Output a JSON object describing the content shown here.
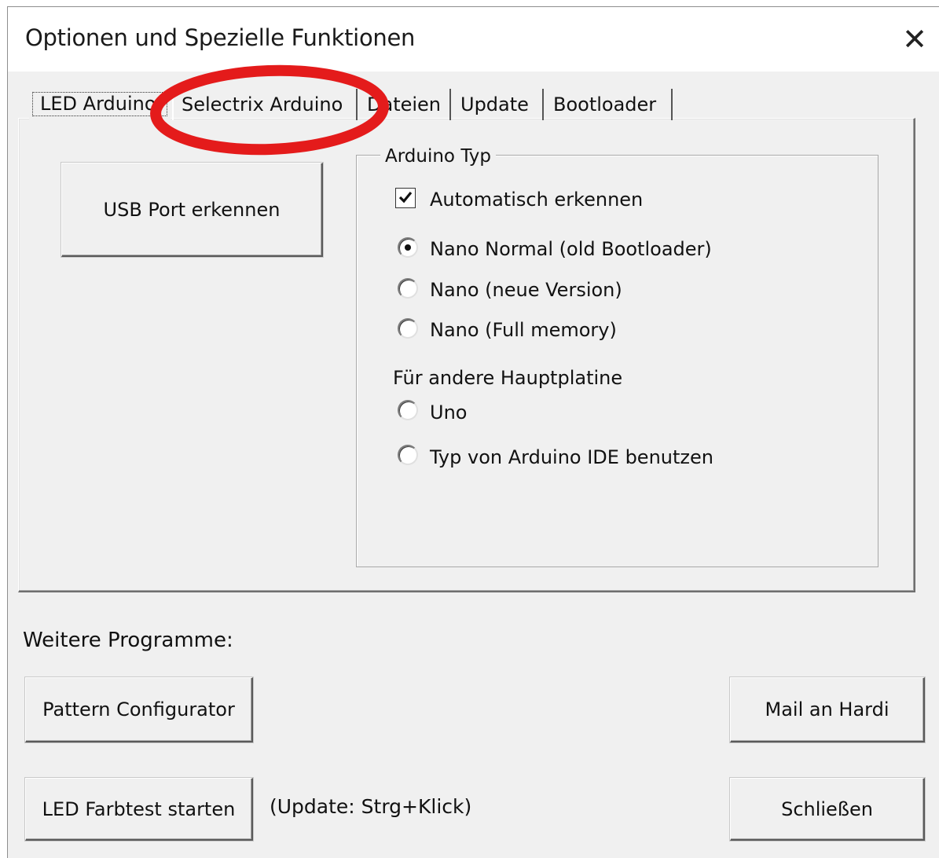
{
  "window": {
    "title": "Optionen und Spezielle Funktionen",
    "close_glyph": "✕"
  },
  "tabs": [
    {
      "label": "LED Arduino",
      "active": true
    },
    {
      "label": "Selectrix Arduino",
      "active": false
    },
    {
      "label": "Dateien",
      "active": false
    },
    {
      "label": "Update",
      "active": false
    },
    {
      "label": "Bootloader",
      "active": false
    }
  ],
  "usb_button": {
    "label": "USB Port erkennen"
  },
  "arduino_group": {
    "legend": "Arduino Typ",
    "auto_detect": {
      "label": "Automatisch erkennen",
      "checked": true
    },
    "options": [
      {
        "label": "Nano Normal (old Bootloader)",
        "selected": true
      },
      {
        "label": "Nano (neue Version)",
        "selected": false
      },
      {
        "label": "Nano (Full memory)",
        "selected": false
      }
    ],
    "other_board_label": "Für andere Hauptplatine",
    "other_options": [
      {
        "label": "Uno",
        "selected": false
      },
      {
        "label": "Typ von Arduino IDE benutzen",
        "selected": false
      }
    ]
  },
  "more_programs": {
    "label": "Weitere Programme:",
    "pattern_button": "Pattern Configurator",
    "color_test_button": "LED Farbtest starten",
    "update_hint": "(Update: Strg+Klick)",
    "mail_button": "Mail an Hardi",
    "close_button": "Schließen"
  },
  "annotation": {
    "color": "#e41b1b",
    "shape": "ellipse"
  }
}
